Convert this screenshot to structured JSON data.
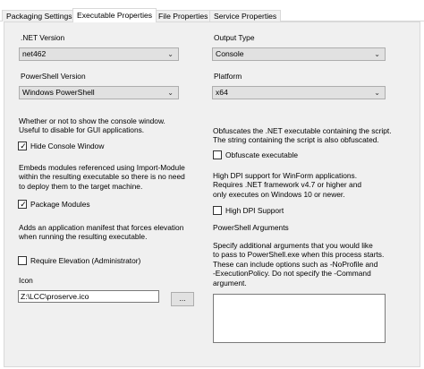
{
  "tabs": [
    {
      "label": "Packaging Settings"
    },
    {
      "label": "Executable Properties"
    },
    {
      "label": "File Properties"
    },
    {
      "label": "Service Properties"
    }
  ],
  "left": {
    "net_version": {
      "label": ".NET Version",
      "value": "net462"
    },
    "powershell_version": {
      "label": "PowerShell Version",
      "value": "Windows PowerShell"
    },
    "hide_console": {
      "desc_lines": [
        "Whether or not to show the console window.",
        "Useful to disable for GUI applications."
      ],
      "label": "Hide Console Window",
      "checked": true
    },
    "package_modules": {
      "desc_lines": [
        "Embeds modules referenced using Import-Module",
        "within the resulting executable so there is no need",
        "to deploy them to the target machine."
      ],
      "label": "Package Modules",
      "checked": true
    },
    "require_elevation": {
      "desc_lines": [
        "Adds an application manifest that forces elevation",
        "when running the resulting executable."
      ],
      "label": "Require Elevation (Administrator)",
      "checked": false
    },
    "icon": {
      "label": "Icon",
      "value": "Z:\\LCC\\proserve.ico",
      "browse_label": "..."
    }
  },
  "right": {
    "output_type": {
      "label": "Output Type",
      "value": "Console"
    },
    "platform": {
      "label": "Platform",
      "value": "x64"
    },
    "obfuscate": {
      "desc_lines": [
        "Obfuscates the .NET executable containing the script.",
        "The string containing the script is also obfuscated."
      ],
      "label": "Obfuscate executable",
      "checked": false
    },
    "high_dpi": {
      "desc_lines": [
        "High DPI support for WinForm applications.",
        "Requires .NET framework v4.7 or higher and",
        "only executes on Windows 10 or newer."
      ],
      "label": "High DPI Support",
      "checked": false
    },
    "ps_arguments": {
      "label": "PowerShell Arguments",
      "desc_lines": [
        "Specify additional arguments that you would like",
        "to pass to PowerShell.exe when this process starts.",
        "These can include options such as -NoProfile and",
        "-ExecutionPolicy. Do not  specify the -Command",
        "argument."
      ],
      "value": ""
    }
  },
  "icons": {
    "dropdown": "chevron-down-icon",
    "check": "checkmark-icon"
  }
}
